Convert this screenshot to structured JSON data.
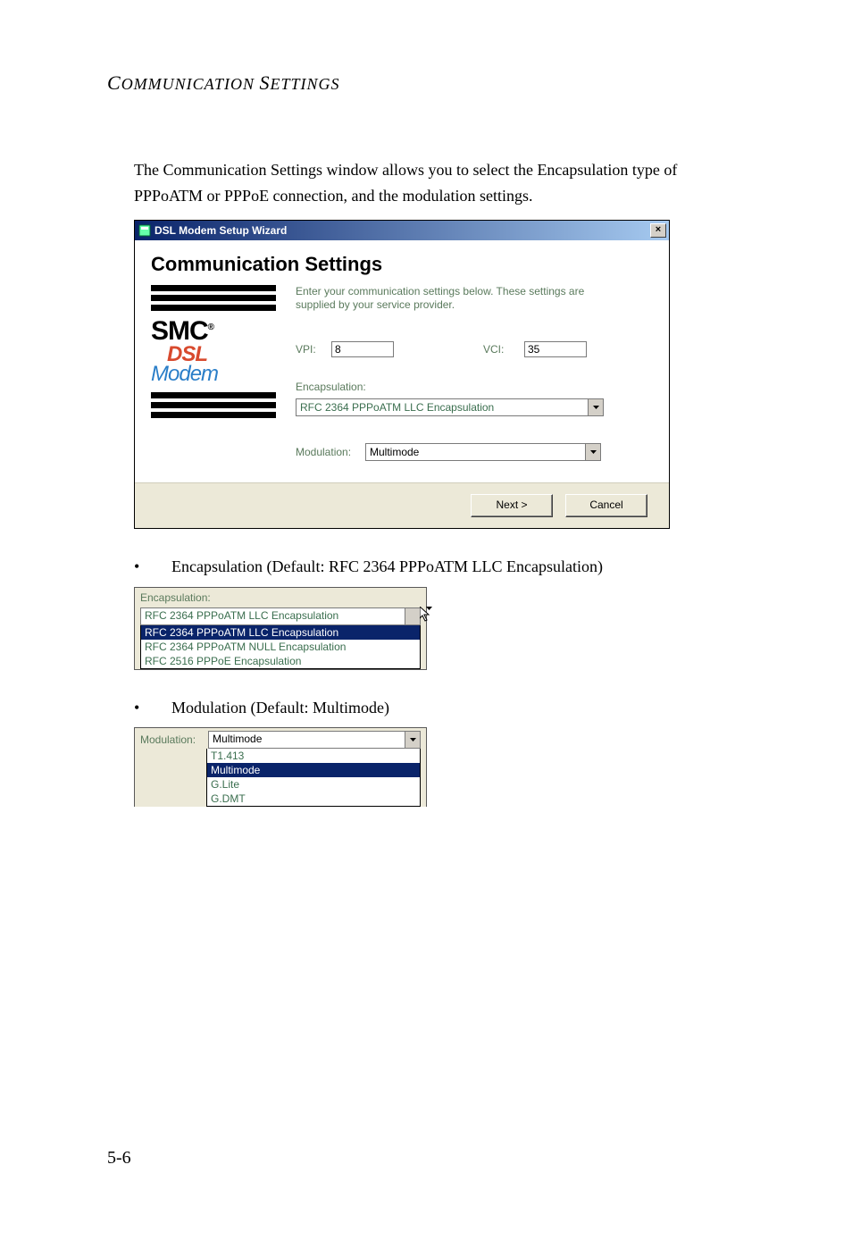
{
  "header": "COMMUNICATION SETTINGS",
  "intro": "The Communication Settings window allows you to select the Encapsulation type of PPPoATM or PPPoE connection, and the modulation settings.",
  "wizard": {
    "title": "DSL Modem Setup Wizard",
    "heading": "Communication Settings",
    "instructions": "Enter your communication settings below.  These settings are supplied by your service provider.",
    "vpi_label": "VPI:",
    "vpi_value": "8",
    "vci_label": "VCI:",
    "vci_value": "35",
    "encap_label": "Encapsulation:",
    "encap_value": "RFC 2364 PPPoATM LLC Encapsulation",
    "mod_label": "Modulation:",
    "mod_value": "Multimode",
    "next_button": "Next >",
    "cancel_button": "Cancel",
    "logo_line1": "SMC",
    "logo_line1_sup": "®",
    "logo_line2": "DSL",
    "logo_line3": "Modem"
  },
  "bullet1": "Encapsulation (Default: RFC 2364 PPPoATM LLC Encapsulation)",
  "encap_box": {
    "label": "Encapsulation:",
    "selected": "RFC 2364 PPPoATM LLC Encapsulation",
    "options": [
      "RFC 2364 PPPoATM LLC Encapsulation",
      "RFC 2364 PPPoATM NULL Encapsulation",
      "RFC 2516 PPPoE Encapsulation"
    ]
  },
  "bullet2": "Modulation (Default: Multimode)",
  "mod_box": {
    "label": "Modulation:",
    "selected": "Multimode",
    "options": [
      "T1.413",
      "Multimode",
      "G.Lite",
      "G.DMT"
    ]
  },
  "page_number": "5-6"
}
